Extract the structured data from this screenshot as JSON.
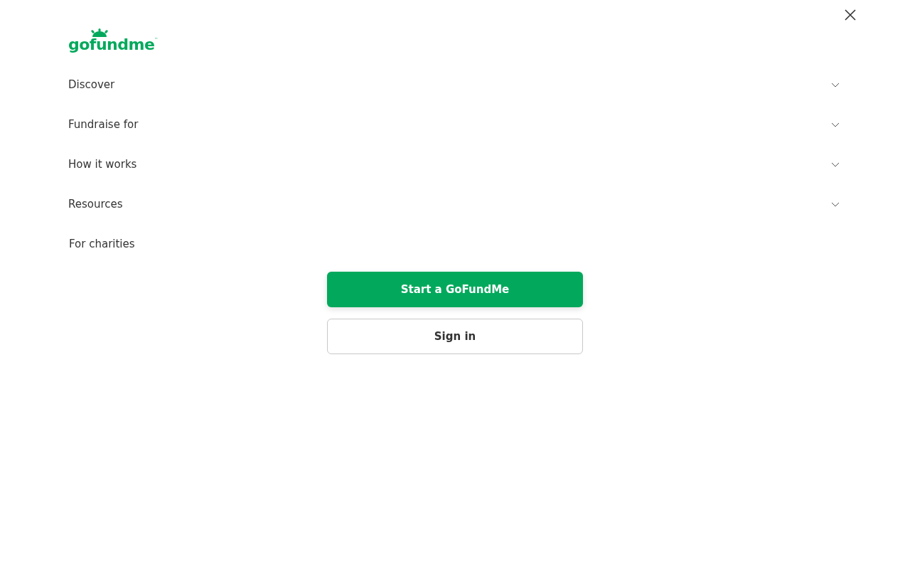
{
  "logo": {
    "text": "gofundme",
    "mark": "™"
  },
  "menu": [
    {
      "label": "Discover",
      "kind": "dropdown",
      "expanded": false
    },
    {
      "label": "Fundraise for",
      "kind": "dropdown",
      "expanded": false
    },
    {
      "label": "How it works",
      "kind": "dropdown",
      "expanded": false
    },
    {
      "label": "Resources",
      "kind": "dropdown",
      "expanded": false
    },
    {
      "label": "For charities",
      "kind": "link"
    }
  ],
  "buttons": [
    {
      "label": "Start a GoFundMe",
      "kind": "primary"
    },
    {
      "label": "Sign in",
      "kind": "secondary"
    }
  ]
}
